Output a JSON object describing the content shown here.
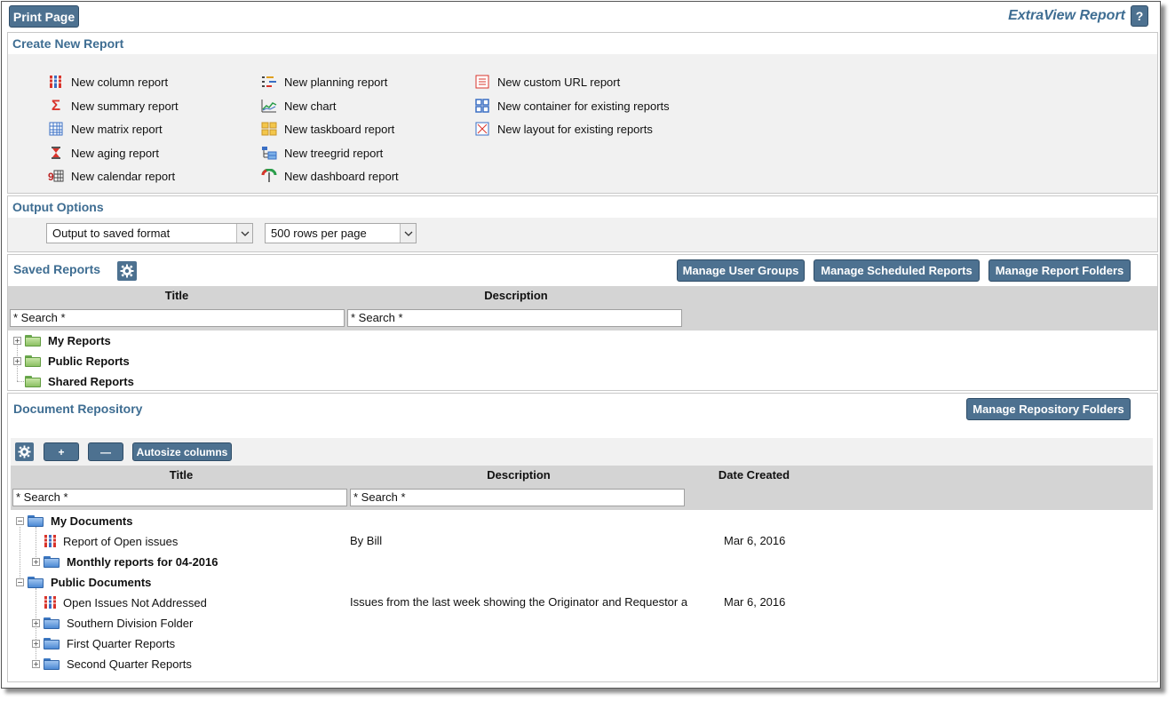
{
  "header": {
    "print_label": "Print Page",
    "app_title": "ExtraView Report",
    "help_label": "?"
  },
  "create": {
    "title": "Create New Report",
    "col1": [
      {
        "label": "New column report",
        "icon": "column-report-icon"
      },
      {
        "label": "New summary report",
        "icon": "summary-report-icon"
      },
      {
        "label": "New matrix report",
        "icon": "matrix-report-icon"
      },
      {
        "label": "New aging report",
        "icon": "aging-report-icon"
      },
      {
        "label": "New calendar report",
        "icon": "calendar-report-icon"
      }
    ],
    "col2": [
      {
        "label": "New planning report",
        "icon": "planning-report-icon"
      },
      {
        "label": "New chart",
        "icon": "chart-icon"
      },
      {
        "label": "New taskboard report",
        "icon": "taskboard-report-icon"
      },
      {
        "label": "New treegrid report",
        "icon": "treegrid-report-icon"
      },
      {
        "label": "New dashboard report",
        "icon": "dashboard-report-icon"
      }
    ],
    "col3": [
      {
        "label": "New custom URL report",
        "icon": "custom-url-report-icon"
      },
      {
        "label": "New container for existing reports",
        "icon": "container-report-icon"
      },
      {
        "label": "New layout for existing reports",
        "icon": "layout-report-icon"
      }
    ]
  },
  "output": {
    "title": "Output Options",
    "format_selected": "Output to saved format",
    "rows_selected": "500 rows per page"
  },
  "saved": {
    "title": "Saved Reports",
    "buttons": {
      "groups": "Manage User Groups",
      "scheduled": "Manage Scheduled Reports",
      "folders": "Manage Report Folders"
    },
    "columns": {
      "title": "Title",
      "description": "Description"
    },
    "search_placeholder": "* Search *",
    "folders": [
      "My Reports",
      "Public Reports",
      "Shared Reports"
    ]
  },
  "repository": {
    "title": "Document Repository",
    "manage_button": "Manage Repository Folders",
    "toolbar": {
      "add": "+",
      "remove": "—",
      "autosize": "Autosize columns"
    },
    "columns": {
      "title": "Title",
      "description": "Description",
      "date": "Date Created"
    },
    "search_placeholder": "* Search *",
    "rows": {
      "my_documents": "My Documents",
      "report_open": {
        "title": "Report of Open issues",
        "description": "By Bill",
        "date": "Mar 6, 2016"
      },
      "monthly": "Monthly reports for 04-2016",
      "public_documents": "Public Documents",
      "open_not_addressed": {
        "title": "Open Issues Not Addressed",
        "description": "Issues from the last week showing the Originator and Requestor a",
        "date": "Mar 6, 2016"
      },
      "southern": "Southern Division Folder",
      "first_q": "First Quarter Reports",
      "second_q": "Second Quarter Reports"
    }
  }
}
